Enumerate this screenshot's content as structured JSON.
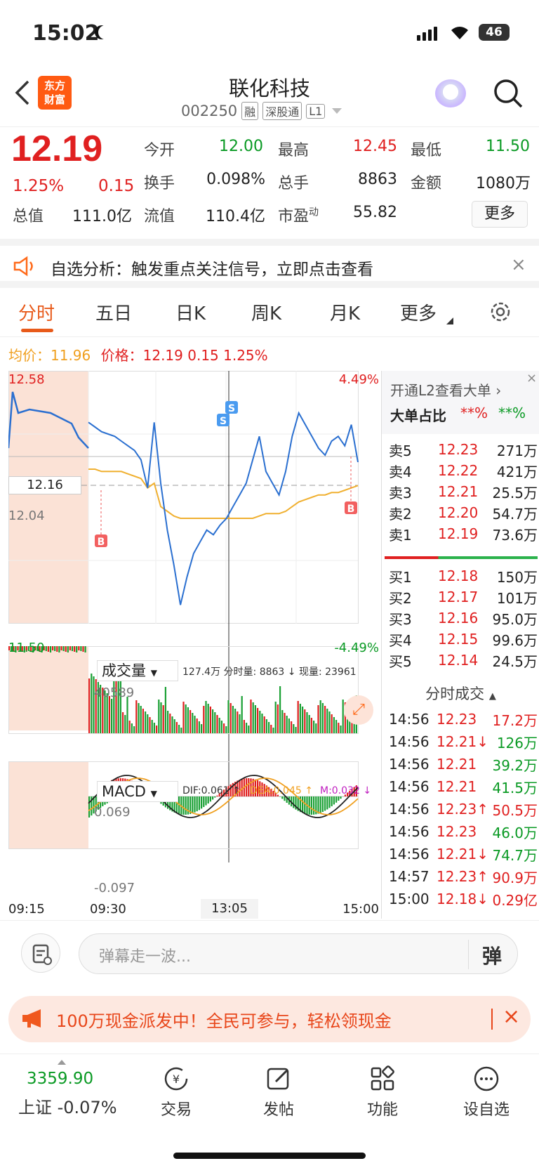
{
  "status": {
    "time": "15:02",
    "battery": "46"
  },
  "header": {
    "logo_line1": "东方",
    "logo_line2": "财富",
    "title": "联化科技",
    "code": "002250",
    "tags": [
      "融",
      "深股通",
      "L1"
    ]
  },
  "quote": {
    "price": "12.19",
    "pct": "1.25%",
    "chg": "0.15",
    "fields": [
      {
        "label": "今开",
        "value": "12.00",
        "color": "green"
      },
      {
        "label": "最高",
        "value": "12.45",
        "color": "red"
      },
      {
        "label": "最低",
        "value": "11.50",
        "color": "green"
      },
      {
        "label": "换手",
        "value": "0.098%",
        "color": "dark"
      },
      {
        "label": "总手",
        "value": "8863",
        "color": "dark"
      },
      {
        "label": "金额",
        "value": "1080万",
        "color": "dark"
      },
      {
        "label": "总值",
        "value": "111.0亿",
        "color": "dark"
      },
      {
        "label": "流值",
        "value": "110.4亿",
        "color": "dark"
      },
      {
        "label": "市盈",
        "sup": "动",
        "value": "55.82",
        "color": "dark"
      }
    ],
    "more_label": "更多"
  },
  "notice": {
    "text": "自选分析：触发重点关注信号，立即点击查看"
  },
  "tabs": [
    "分时",
    "五日",
    "日K",
    "周K",
    "月K",
    "更多"
  ],
  "chart": {
    "avg_label": "均价：11.96",
    "price_label": "价格：12.19  0.15  1.25%",
    "y_top": "12.58",
    "y_bottom": "11.50",
    "pct_top": "4.49%",
    "pct_bottom": "-4.49%",
    "crosshair_price": "12.16",
    "ref_price": "12.04",
    "vol_selector": "成交量",
    "vol_info": "127.4万 分时量: 8863 ↓ 现量: 23961",
    "vol_max": "40589",
    "macd_selector": "MACD",
    "dif": "DIF:0.061 ↑",
    "dea": "DEA:0.045 ↑",
    "m": "M:0.032 ↓",
    "macd_top": "0.069",
    "macd_bottom": "-0.097",
    "times": [
      "09:15",
      "09:30",
      "13:05",
      "15:00"
    ]
  },
  "chart_data": {
    "type": "line",
    "series": [
      {
        "name": "价格",
        "values": [
          12.36,
          12.34,
          12.32,
          12.31,
          12.3,
          12.28,
          12.26,
          12.24,
          12.2,
          12.08,
          12.36,
          12.1,
          11.9,
          11.75,
          11.58,
          11.7,
          11.8,
          11.85,
          11.9,
          11.88,
          11.92,
          11.95,
          12.0,
          12.05,
          12.1,
          12.2,
          12.3,
          12.15,
          12.1,
          12.05,
          12.15,
          12.3,
          12.4,
          12.35,
          12.3,
          12.25,
          12.22,
          12.28,
          12.3,
          12.26,
          12.35,
          12.19
        ]
      },
      {
        "name": "均价",
        "values": [
          12.16,
          12.16,
          12.15,
          12.15,
          12.15,
          12.15,
          12.14,
          12.13,
          12.12,
          12.08,
          12.1,
          12.0,
          11.98,
          11.96,
          11.95,
          11.95,
          11.95,
          11.95,
          11.95,
          11.95,
          11.95,
          11.95,
          11.95,
          11.95,
          11.95,
          11.95,
          11.96,
          11.97,
          11.97,
          11.97,
          11.98,
          12.0,
          12.02,
          12.03,
          12.04,
          12.05,
          12.05,
          12.06,
          12.06,
          12.07,
          12.08,
          12.09
        ]
      }
    ],
    "ylim": [
      11.5,
      12.58
    ]
  },
  "orderbook": {
    "header": "开通L2查看大单 ›",
    "ratio_label": "大单占比",
    "ratio_red": "**%",
    "ratio_green": "**%",
    "asks": [
      {
        "label": "卖5",
        "price": "12.23",
        "vol": "271万"
      },
      {
        "label": "卖4",
        "price": "12.22",
        "vol": "421万"
      },
      {
        "label": "卖3",
        "price": "12.21",
        "vol": "25.5万"
      },
      {
        "label": "卖2",
        "price": "12.20",
        "vol": "54.7万"
      },
      {
        "label": "卖1",
        "price": "12.19",
        "vol": "73.6万"
      }
    ],
    "bids": [
      {
        "label": "买1",
        "price": "12.18",
        "vol": "150万"
      },
      {
        "label": "买2",
        "price": "12.17",
        "vol": "101万"
      },
      {
        "label": "买3",
        "price": "12.16",
        "vol": "95.0万"
      },
      {
        "label": "买4",
        "price": "12.15",
        "vol": "99.6万"
      },
      {
        "label": "买5",
        "price": "12.14",
        "vol": "24.5万"
      }
    ],
    "ticks_title": "分时成交",
    "ticks": [
      {
        "time": "14:56",
        "price": "12.23",
        "pc": "red",
        "vol": "17.2万",
        "vc": "red"
      },
      {
        "time": "14:56",
        "price": "12.21↓",
        "pc": "red",
        "vol": "126万",
        "vc": "green"
      },
      {
        "time": "14:56",
        "price": "12.21",
        "pc": "red",
        "vol": "39.2万",
        "vc": "green"
      },
      {
        "time": "14:56",
        "price": "12.21",
        "pc": "red",
        "vol": "41.5万",
        "vc": "green"
      },
      {
        "time": "14:56",
        "price": "12.23↑",
        "pc": "red",
        "vol": "50.5万",
        "vc": "red"
      },
      {
        "time": "14:56",
        "price": "12.23",
        "pc": "red",
        "vol": "46.0万",
        "vc": "green"
      },
      {
        "time": "14:56",
        "price": "12.21↓",
        "pc": "red",
        "vol": "74.7万",
        "vc": "green"
      },
      {
        "time": "14:57",
        "price": "12.23↑",
        "pc": "red",
        "vol": "90.9万",
        "vc": "red"
      },
      {
        "time": "15:00",
        "price": "12.18↓",
        "pc": "red",
        "vol": "0.29亿",
        "vc": "red"
      }
    ]
  },
  "input": {
    "placeholder": "弹幕走一波..."
  },
  "promo": {
    "text": "100万现金派发中！全民可参与，轻松领现金"
  },
  "nav": {
    "index_value": "3359.90",
    "index_label": "上证 -0.07%",
    "items": [
      "交易",
      "发帖",
      "功能",
      "设自选"
    ]
  }
}
